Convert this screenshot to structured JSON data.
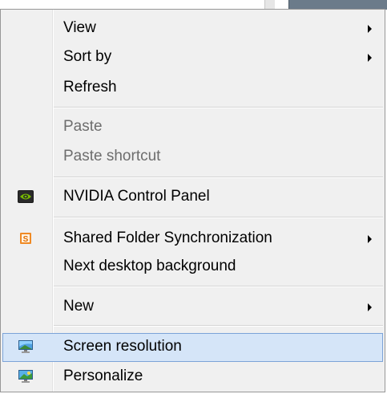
{
  "menu": {
    "items": [
      {
        "label": "View",
        "submenu": true,
        "enabled": true
      },
      {
        "label": "Sort by",
        "submenu": true,
        "enabled": true
      },
      {
        "label": "Refresh",
        "submenu": false,
        "enabled": true
      },
      {
        "label": "Paste",
        "submenu": false,
        "enabled": false
      },
      {
        "label": "Paste shortcut",
        "submenu": false,
        "enabled": false
      },
      {
        "label": "NVIDIA Control Panel",
        "submenu": false,
        "enabled": true,
        "icon": "nvidia-icon"
      },
      {
        "label": "Shared Folder Synchronization",
        "submenu": true,
        "enabled": true,
        "icon": "shared-folder-sync-icon"
      },
      {
        "label": "Next desktop background",
        "submenu": false,
        "enabled": true
      },
      {
        "label": "New",
        "submenu": true,
        "enabled": true
      },
      {
        "label": "Screen resolution",
        "submenu": false,
        "enabled": true,
        "icon": "screen-resolution-icon",
        "highlighted": true
      },
      {
        "label": "Personalize",
        "submenu": false,
        "enabled": true,
        "icon": "personalize-icon"
      }
    ]
  },
  "colors": {
    "menu_bg": "#f0f0f0",
    "hover_bg": "#d5e5f8",
    "hover_border": "#7ca3d8",
    "disabled_text": "#6d6d6d",
    "nvidia_green": "#76b900",
    "shared_orange": "#f08a24"
  }
}
